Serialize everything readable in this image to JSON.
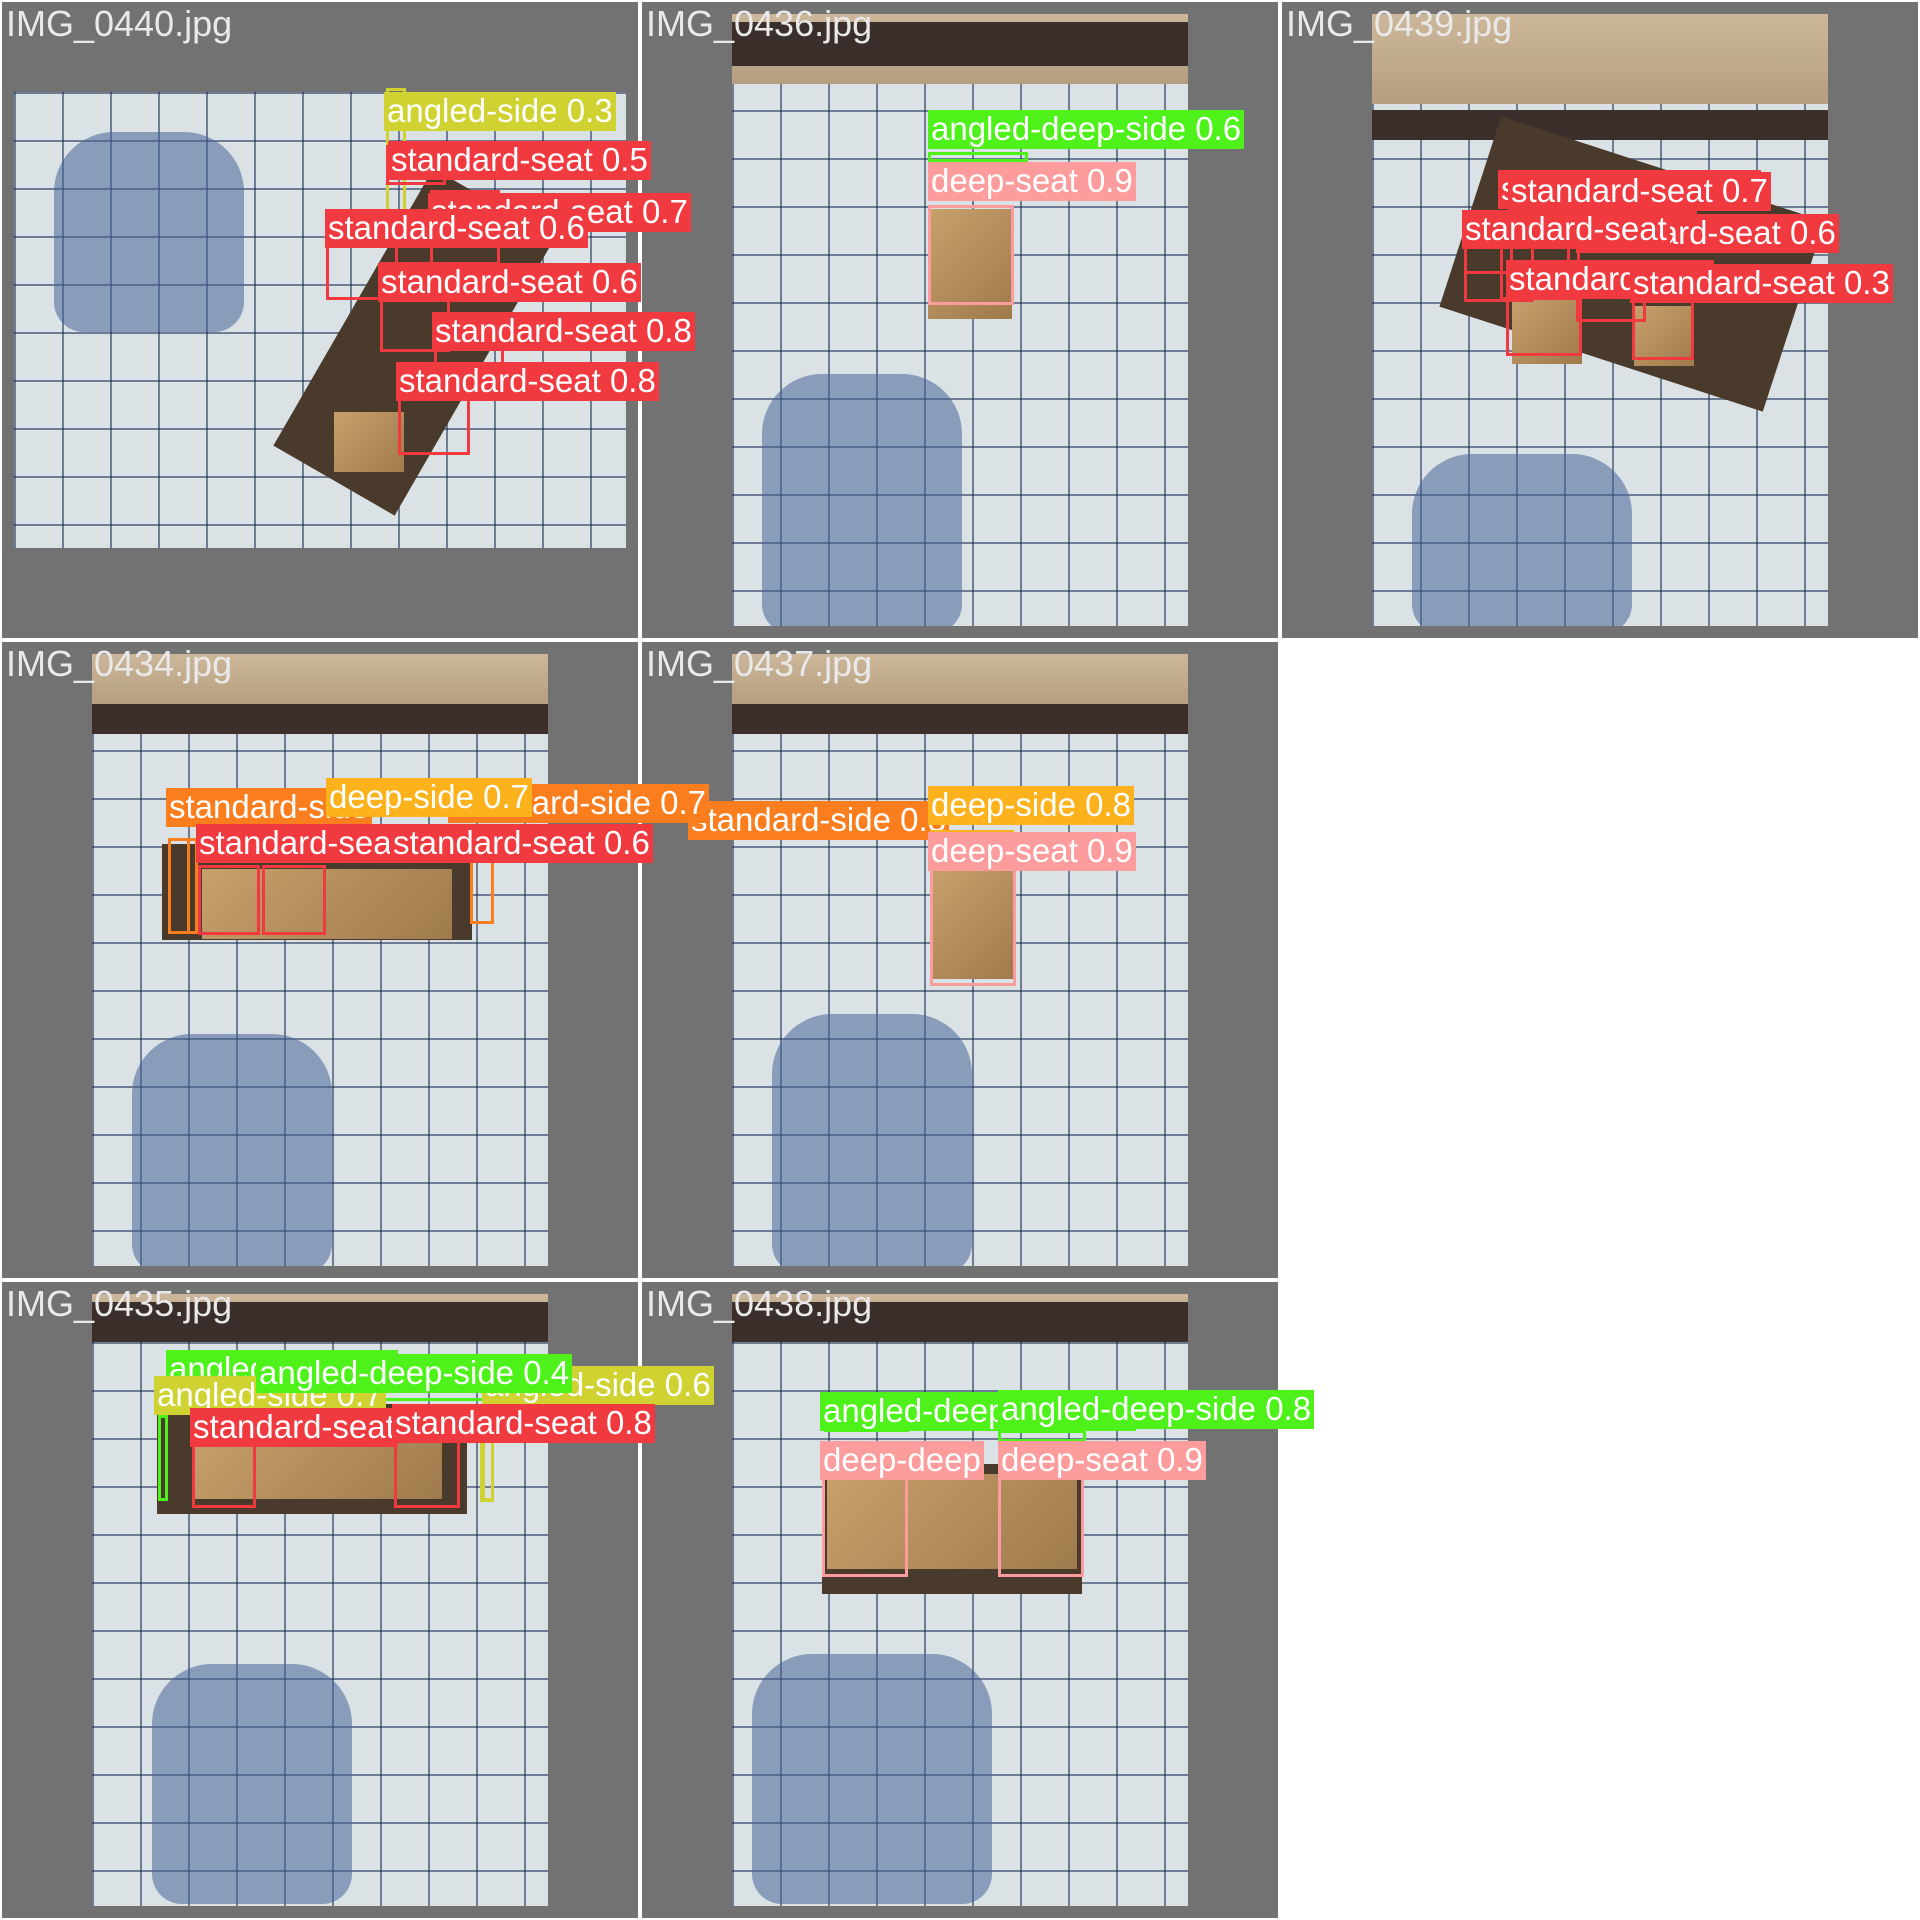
{
  "colors": {
    "standard_seat": "#f03a40",
    "angled_side": "#cfd231",
    "angled_deep_side": "#4ef21a",
    "deep_seat": "#fc9c9c",
    "deep_side": "#fcb21c",
    "standard_side": "#fb7e1e",
    "tile_bg": "#727272"
  },
  "tiles": [
    {
      "id": "t1",
      "label": "IMG_0440.jpg"
    },
    {
      "id": "t2",
      "label": "IMG_0436.jpg"
    },
    {
      "id": "t3",
      "label": "IMG_0439.jpg"
    },
    {
      "id": "t4",
      "label": "IMG_0434.jpg"
    },
    {
      "id": "t5",
      "label": "IMG_0437.jpg"
    },
    {
      "id": "t6",
      "label": "IMG_0435.jpg"
    },
    {
      "id": "t7",
      "label": "IMG_0438.jpg"
    }
  ],
  "detections": {
    "t1": [
      {
        "text": "angled-side 0.3",
        "cls": "angled_side"
      },
      {
        "text": "standard-seat 0.5",
        "cls": "standard_seat"
      },
      {
        "text": "standard-seat 0.7",
        "cls": "standard_seat"
      },
      {
        "text": "standard-seat 0.6",
        "cls": "standard_seat"
      },
      {
        "text": "standard-seat 0.6",
        "cls": "standard_seat"
      },
      {
        "text": "standard-seat 0.8",
        "cls": "standard_seat"
      },
      {
        "text": "standard-seat 0.8",
        "cls": "standard_seat"
      }
    ],
    "t2": [
      {
        "text": "angled-deep-side 0.6",
        "cls": "angled_deep_side"
      },
      {
        "text": "deep-seat 0.9",
        "cls": "deep_seat"
      }
    ],
    "t3": [
      {
        "text": "standard-seat 0.8",
        "cls": "standard_seat"
      },
      {
        "text": "standard-seat 0.7",
        "cls": "standard_seat"
      },
      {
        "text": "standard-seat 0",
        "cls": "standard_seat"
      },
      {
        "text": "standard-seat 0.6",
        "cls": "standard_seat"
      },
      {
        "text": "standard-seat",
        "cls": "standard_seat"
      },
      {
        "text": "standard-seat 0.3",
        "cls": "standard_seat"
      },
      {
        "text": "standard-seat",
        "cls": "standard_seat"
      }
    ],
    "t4": [
      {
        "text": "standard-side 0.8",
        "cls": "standard_side"
      },
      {
        "text": "standard-side 0.7",
        "cls": "standard_side"
      },
      {
        "text": "standard-side",
        "cls": "standard_side"
      },
      {
        "text": "deep-side 0.7",
        "cls": "deep_side"
      },
      {
        "text": "standard-seat",
        "cls": "standard_seat"
      },
      {
        "text": "standard-seat 0.6",
        "cls": "standard_seat"
      }
    ],
    "t5": [
      {
        "text": "deep-side 0.8",
        "cls": "deep_side"
      },
      {
        "text": "deep-seat 0.9",
        "cls": "deep_seat"
      }
    ],
    "t6": [
      {
        "text": "angled-side 0.7",
        "cls": "angled_deep_side"
      },
      {
        "text": "angled-side 0.7",
        "cls": "angled_side"
      },
      {
        "text": "angled-side 0.6",
        "cls": "angled_side"
      },
      {
        "text": "angled-deep-side 0.4",
        "cls": "angled_deep_side"
      },
      {
        "text": "standard-seat",
        "cls": "standard_seat"
      },
      {
        "text": "standard-seat 0.8",
        "cls": "standard_seat"
      }
    ],
    "t7": [
      {
        "text": "angled-deep-side 0.8",
        "cls": "angled_deep_side"
      },
      {
        "text": "angled-deep-side 0.8",
        "cls": "angled_deep_side"
      },
      {
        "text": "deep-deep",
        "cls": "deep_seat"
      },
      {
        "text": "deep-seat 0.9",
        "cls": "deep_seat"
      }
    ]
  }
}
